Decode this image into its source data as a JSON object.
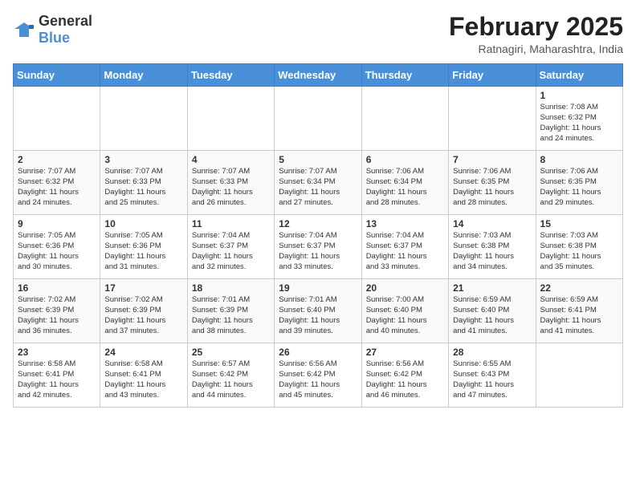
{
  "logo": {
    "general": "General",
    "blue": "Blue"
  },
  "title": "February 2025",
  "subtitle": "Ratnagiri, Maharashtra, India",
  "days_of_week": [
    "Sunday",
    "Monday",
    "Tuesday",
    "Wednesday",
    "Thursday",
    "Friday",
    "Saturday"
  ],
  "weeks": [
    [
      {
        "day": "",
        "info": ""
      },
      {
        "day": "",
        "info": ""
      },
      {
        "day": "",
        "info": ""
      },
      {
        "day": "",
        "info": ""
      },
      {
        "day": "",
        "info": ""
      },
      {
        "day": "",
        "info": ""
      },
      {
        "day": "1",
        "info": "Sunrise: 7:08 AM\nSunset: 6:32 PM\nDaylight: 11 hours\nand 24 minutes."
      }
    ],
    [
      {
        "day": "2",
        "info": "Sunrise: 7:07 AM\nSunset: 6:32 PM\nDaylight: 11 hours\nand 24 minutes."
      },
      {
        "day": "3",
        "info": "Sunrise: 7:07 AM\nSunset: 6:33 PM\nDaylight: 11 hours\nand 25 minutes."
      },
      {
        "day": "4",
        "info": "Sunrise: 7:07 AM\nSunset: 6:33 PM\nDaylight: 11 hours\nand 26 minutes."
      },
      {
        "day": "5",
        "info": "Sunrise: 7:07 AM\nSunset: 6:34 PM\nDaylight: 11 hours\nand 27 minutes."
      },
      {
        "day": "6",
        "info": "Sunrise: 7:06 AM\nSunset: 6:34 PM\nDaylight: 11 hours\nand 28 minutes."
      },
      {
        "day": "7",
        "info": "Sunrise: 7:06 AM\nSunset: 6:35 PM\nDaylight: 11 hours\nand 28 minutes."
      },
      {
        "day": "8",
        "info": "Sunrise: 7:06 AM\nSunset: 6:35 PM\nDaylight: 11 hours\nand 29 minutes."
      }
    ],
    [
      {
        "day": "9",
        "info": "Sunrise: 7:05 AM\nSunset: 6:36 PM\nDaylight: 11 hours\nand 30 minutes."
      },
      {
        "day": "10",
        "info": "Sunrise: 7:05 AM\nSunset: 6:36 PM\nDaylight: 11 hours\nand 31 minutes."
      },
      {
        "day": "11",
        "info": "Sunrise: 7:04 AM\nSunset: 6:37 PM\nDaylight: 11 hours\nand 32 minutes."
      },
      {
        "day": "12",
        "info": "Sunrise: 7:04 AM\nSunset: 6:37 PM\nDaylight: 11 hours\nand 33 minutes."
      },
      {
        "day": "13",
        "info": "Sunrise: 7:04 AM\nSunset: 6:37 PM\nDaylight: 11 hours\nand 33 minutes."
      },
      {
        "day": "14",
        "info": "Sunrise: 7:03 AM\nSunset: 6:38 PM\nDaylight: 11 hours\nand 34 minutes."
      },
      {
        "day": "15",
        "info": "Sunrise: 7:03 AM\nSunset: 6:38 PM\nDaylight: 11 hours\nand 35 minutes."
      }
    ],
    [
      {
        "day": "16",
        "info": "Sunrise: 7:02 AM\nSunset: 6:39 PM\nDaylight: 11 hours\nand 36 minutes."
      },
      {
        "day": "17",
        "info": "Sunrise: 7:02 AM\nSunset: 6:39 PM\nDaylight: 11 hours\nand 37 minutes."
      },
      {
        "day": "18",
        "info": "Sunrise: 7:01 AM\nSunset: 6:39 PM\nDaylight: 11 hours\nand 38 minutes."
      },
      {
        "day": "19",
        "info": "Sunrise: 7:01 AM\nSunset: 6:40 PM\nDaylight: 11 hours\nand 39 minutes."
      },
      {
        "day": "20",
        "info": "Sunrise: 7:00 AM\nSunset: 6:40 PM\nDaylight: 11 hours\nand 40 minutes."
      },
      {
        "day": "21",
        "info": "Sunrise: 6:59 AM\nSunset: 6:40 PM\nDaylight: 11 hours\nand 41 minutes."
      },
      {
        "day": "22",
        "info": "Sunrise: 6:59 AM\nSunset: 6:41 PM\nDaylight: 11 hours\nand 41 minutes."
      }
    ],
    [
      {
        "day": "23",
        "info": "Sunrise: 6:58 AM\nSunset: 6:41 PM\nDaylight: 11 hours\nand 42 minutes."
      },
      {
        "day": "24",
        "info": "Sunrise: 6:58 AM\nSunset: 6:41 PM\nDaylight: 11 hours\nand 43 minutes."
      },
      {
        "day": "25",
        "info": "Sunrise: 6:57 AM\nSunset: 6:42 PM\nDaylight: 11 hours\nand 44 minutes."
      },
      {
        "day": "26",
        "info": "Sunrise: 6:56 AM\nSunset: 6:42 PM\nDaylight: 11 hours\nand 45 minutes."
      },
      {
        "day": "27",
        "info": "Sunrise: 6:56 AM\nSunset: 6:42 PM\nDaylight: 11 hours\nand 46 minutes."
      },
      {
        "day": "28",
        "info": "Sunrise: 6:55 AM\nSunset: 6:43 PM\nDaylight: 11 hours\nand 47 minutes."
      },
      {
        "day": "",
        "info": ""
      }
    ]
  ]
}
